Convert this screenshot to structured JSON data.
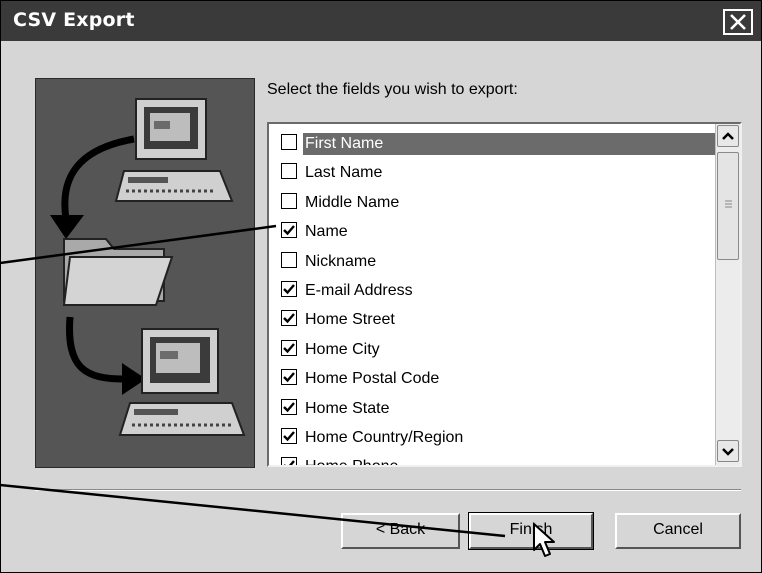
{
  "window": {
    "title": "CSV Export"
  },
  "prompt": "Select the fields you wish to export:",
  "fields": [
    {
      "label": "First Name",
      "checked": false,
      "selected": true
    },
    {
      "label": "Last Name",
      "checked": false,
      "selected": false
    },
    {
      "label": "Middle Name",
      "checked": false,
      "selected": false
    },
    {
      "label": "Name",
      "checked": true,
      "selected": false
    },
    {
      "label": "Nickname",
      "checked": false,
      "selected": false
    },
    {
      "label": "E-mail Address",
      "checked": true,
      "selected": false
    },
    {
      "label": "Home Street",
      "checked": true,
      "selected": false
    },
    {
      "label": "Home City",
      "checked": true,
      "selected": false
    },
    {
      "label": "Home Postal Code",
      "checked": true,
      "selected": false
    },
    {
      "label": "Home State",
      "checked": true,
      "selected": false
    },
    {
      "label": "Home Country/Region",
      "checked": true,
      "selected": false
    },
    {
      "label": "Home Phone",
      "checked": true,
      "selected": false
    }
  ],
  "buttons": {
    "back": "< Back",
    "finish": "Finish",
    "cancel": "Cancel"
  },
  "icons": {
    "close": "close-icon",
    "scroll_up": "chevron-up-icon",
    "scroll_down": "chevron-down-icon",
    "check": "checkmark-icon",
    "cursor": "mouse-pointer-icon"
  },
  "colors": {
    "titlebar": "#3a3a3a",
    "dialog": "#d6d6d6",
    "selection": "#6b6b6b",
    "illustration_bg": "#555555"
  }
}
